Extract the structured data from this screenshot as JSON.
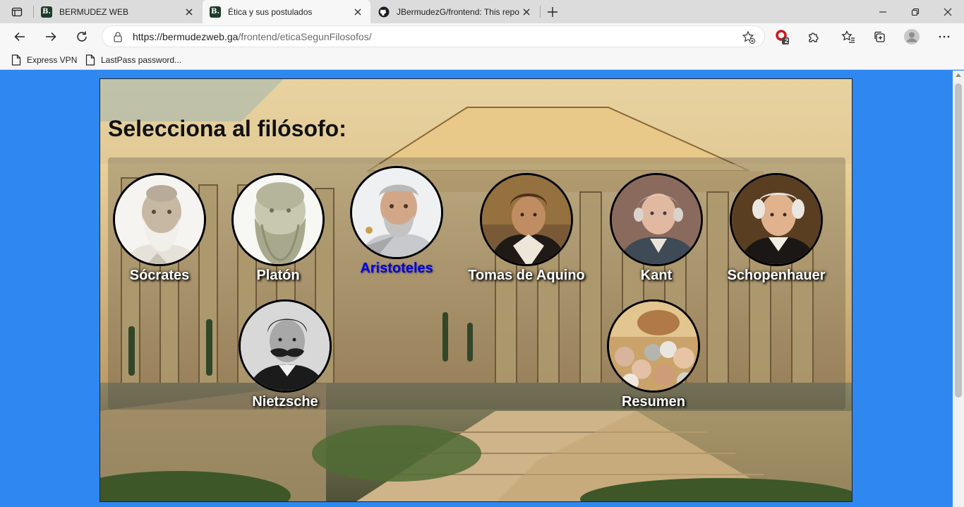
{
  "browser": {
    "tabs": [
      {
        "title": "BERMUDEZ WEB",
        "favicon": "B."
      },
      {
        "title": "Ética y sus postulados",
        "favicon": "B."
      },
      {
        "title": "JBermudezG/frontend: This repo"
      }
    ],
    "url_host": "https://bermudezweb.ga",
    "url_path": "/frontend/eticaSegunFilosofos/",
    "extension_badge": "2",
    "bookmarks": [
      "Express VPN",
      "LastPass password..."
    ]
  },
  "page": {
    "heading": "Selecciona al filósofo:",
    "philosophers": [
      {
        "name": "Sócrates",
        "hovered": false
      },
      {
        "name": "Platón",
        "hovered": false
      },
      {
        "name": "Aristoteles",
        "hovered": true
      },
      {
        "name": "Tomas de Aquino",
        "hovered": false
      },
      {
        "name": "Kant",
        "hovered": false
      },
      {
        "name": "Schopenhauer",
        "hovered": false
      },
      {
        "name": "Nietzsche",
        "hovered": false
      },
      {
        "name": "Resumen",
        "hovered": false
      }
    ]
  },
  "colors": {
    "page_background": "#2e88f0",
    "link_hover": "#0000ee",
    "label_text": "#ffffff"
  }
}
